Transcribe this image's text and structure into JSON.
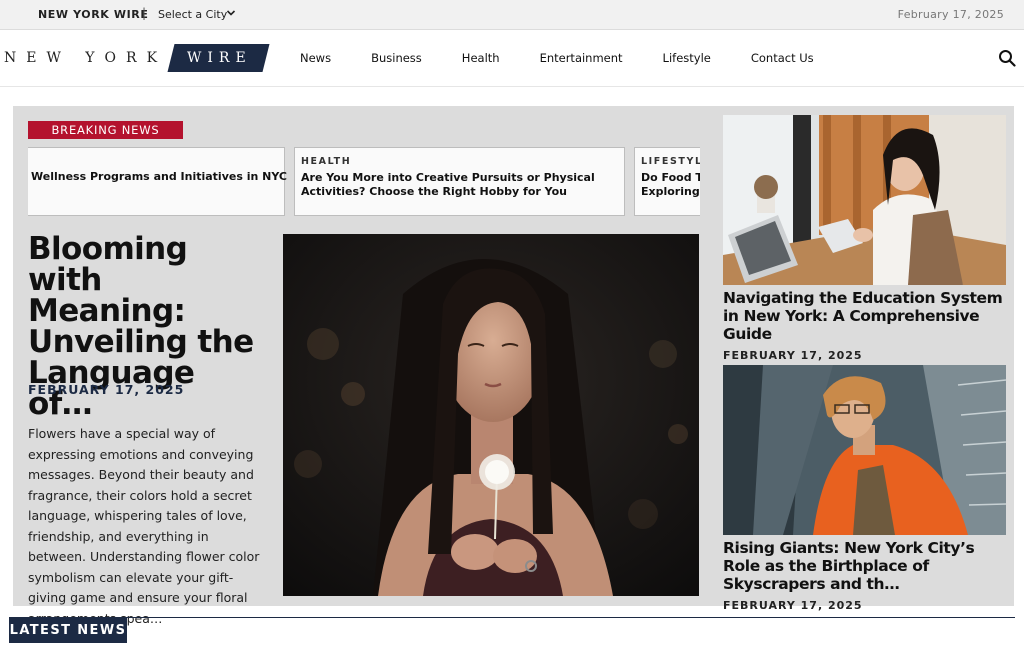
{
  "topbar": {
    "brand": "NEW YORK WIRE",
    "separator": "|",
    "city_select": "Select a City",
    "date": "February 17, 2025"
  },
  "header": {
    "logo_left": "NEW YORK",
    "logo_right": "WIRE",
    "nav": [
      "News",
      "Business",
      "Health",
      "Entertainment",
      "Lifestyle",
      "Contact Us"
    ]
  },
  "breaking": {
    "label": "BREAKING NEWS",
    "items": [
      {
        "category": "",
        "title": "Wellness Programs and Initiatives in NYC"
      },
      {
        "category": "HEALTH",
        "title": "Are You More into Creative Pursuits or Physical",
        "title2": "Activities? Choose the Right Hobby for You"
      },
      {
        "category": "LIFESTYLE",
        "title": "Do Food To",
        "title2": "Exploring"
      }
    ]
  },
  "main_story": {
    "headline": "Blooming with Meaning: Unveiling the Language of…",
    "date": "FEBRUARY 17, 2025",
    "excerpt": "Flowers have a special way of expressing emotions and conveying messages. Beyond their beauty and fragrance, their colors hold a secret language, whispering tales of love, friendship, and everything in between. Understanding flower color symbolism can elevate your gift-giving game and ensure your floral arrangements spea…"
  },
  "side_stories": [
    {
      "title": "Navigating the Education System in New York: A Comprehensive Guide",
      "date": "FEBRUARY 17, 2025"
    },
    {
      "title": "Rising Giants: New York City’s Role as the Birthplace of Skyscrapers and th…",
      "date": "FEBRUARY 17, 2025"
    }
  ],
  "latest_news": {
    "label": "LATEST NEWS"
  },
  "colors": {
    "navy": "#1c2a44",
    "breaking_red": "#b4122e",
    "panel_gray": "#dcdcdc"
  }
}
